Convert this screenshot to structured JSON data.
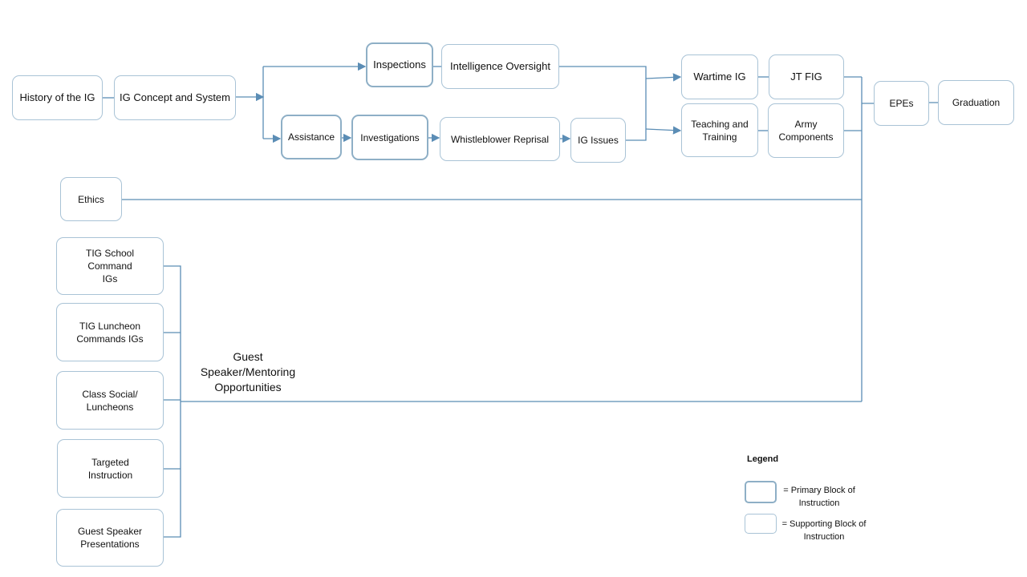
{
  "line_color": "#5b8db5",
  "nodes": {
    "history": "History of the IG",
    "concept": "IG Concept and System",
    "inspections": "Inspections",
    "intel": "Intelligence Oversight",
    "assistance": "Assistance",
    "investigations": "Investigations",
    "whistle": "Whistleblower Reprisal",
    "issues": "IG Issues",
    "wartime": "Wartime IG",
    "jtfig": "JT FIG",
    "teaching": "Teaching and Training",
    "army": "Army Components",
    "epes": "EPEs",
    "graduation": "Graduation",
    "ethics": "Ethics",
    "tig_school": "TIG School Command IGs",
    "tig_lunch": "TIG Luncheon Commands IGs",
    "social": "Class Social/ Luncheons",
    "targeted": "Targeted Instruction",
    "guest": "Guest Speaker Presentations"
  },
  "guest_label": "Guest Speaker/Mentoring Opportunities",
  "legend": {
    "title": "Legend",
    "primary": "= Primary Block of Instruction",
    "supporting": "= Supporting Block of Instruction"
  }
}
